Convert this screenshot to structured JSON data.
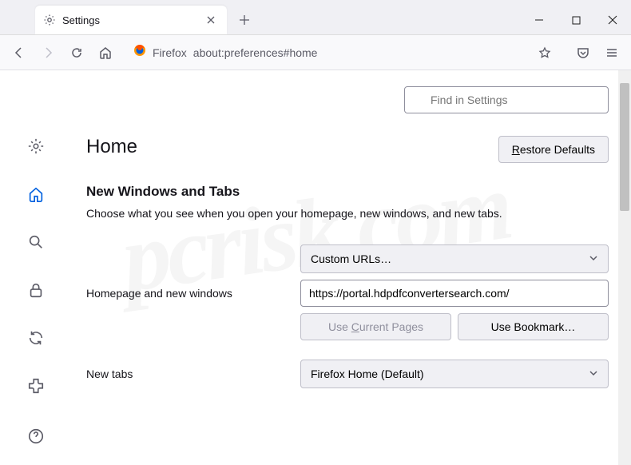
{
  "window": {
    "tab_title": "Settings"
  },
  "urlbar": {
    "identity": "Firefox",
    "path": "about:preferences#home"
  },
  "search": {
    "placeholder": "Find in Settings"
  },
  "page": {
    "title": "Home",
    "restore_btn_prefix": "R",
    "restore_btn_rest": "estore Defaults"
  },
  "section": {
    "title": "New Windows and Tabs",
    "desc": "Choose what you see when you open your homepage, new windows, and new tabs."
  },
  "homepage": {
    "dropdown": "Custom URLs…",
    "label": "Homepage and new windows",
    "url": "https://portal.hdpdfconvertersearch.com/",
    "use_current_pre": "Use ",
    "use_current_ak": "C",
    "use_current_post": "urrent Pages",
    "use_bookmark": "Use Bookmark…"
  },
  "newtabs": {
    "label": "New tabs",
    "dropdown": "Firefox Home (Default)"
  }
}
